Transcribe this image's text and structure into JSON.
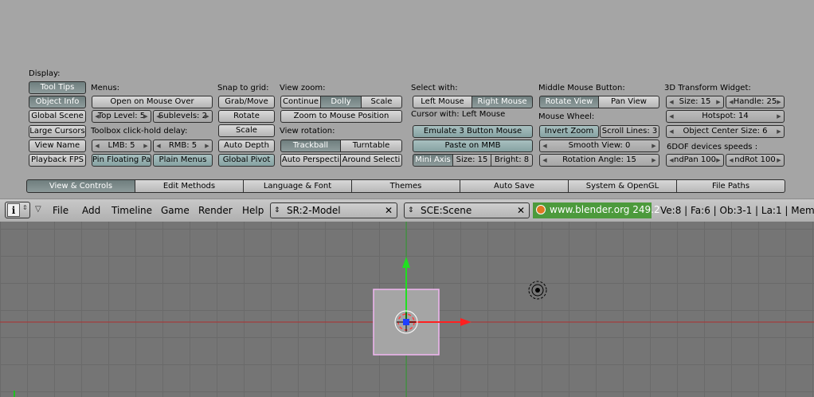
{
  "user_prefs": {
    "display": {
      "heading": "Display:",
      "buttons": [
        "Tool Tips",
        "Object Info",
        "Global Scene",
        "Large Cursors",
        "View Name",
        "Playback FPS"
      ]
    },
    "menus": {
      "heading": "Menus:",
      "open_on_mouse_over": "Open on Mouse Over",
      "top_level": "Top Level: 5",
      "sublevels": "Sublevels: 2",
      "toolbox_heading": "Toolbox click-hold delay:",
      "lmb": "LMB: 5",
      "rmb": "RMB: 5",
      "pin_floating": "Pin Floating Pa",
      "plain_menus": "Plain Menus"
    },
    "snap": {
      "heading": "Snap to grid:",
      "grab_move": "Grab/Move",
      "rotate": "Rotate",
      "scale": "Scale",
      "auto_depth": "Auto Depth",
      "global_pivot": "Global Pivot"
    },
    "view_zoom": {
      "heading": "View zoom:",
      "continue": "Continue",
      "dolly": "Dolly",
      "scale": "Scale",
      "zoom_to_mouse": "Zoom to Mouse Position",
      "rotation_heading": "View rotation:",
      "trackball": "Trackball",
      "turntable": "Turntable",
      "auto_perspective": "Auto Perspecti",
      "around_selection": "Around Selecti"
    },
    "select": {
      "heading": "Select with:",
      "left_mouse": "Left Mouse",
      "right_mouse": "Right Mouse",
      "cursor_with": "Cursor with: Left Mouse",
      "emulate_3_button": "Emulate 3 Button Mouse",
      "paste_on_mmb": "Paste on MMB",
      "mini_axis": "Mini Axis",
      "size": "Size: 15",
      "bright": "Bright: 8"
    },
    "middle_mouse": {
      "heading": "Middle Mouse Button:",
      "rotate_view": "Rotate View",
      "pan_view": "Pan View",
      "wheel_heading": "Mouse Wheel:",
      "invert_zoom": "Invert Zoom",
      "scroll_lines": "Scroll Lines: 3",
      "smooth_view": "Smooth View: 0",
      "rotation_angle": "Rotation Angle: 15"
    },
    "transform_widget": {
      "heading": "3D Transform Widget:",
      "size": "Size: 15",
      "handle": "Handle: 25",
      "hotspot": "Hotspot: 14",
      "object_center_size": "Object Center Size: 6",
      "ndof_heading": "6DOF devices speeds :",
      "ndpan": "ndPan 100",
      "ndrot": "ndRot 100"
    },
    "tabs": [
      "View & Controls",
      "Edit Methods",
      "Language & Font",
      "Themes",
      "Auto Save",
      "System & OpenGL",
      "File Paths"
    ],
    "active_tab": "View & Controls"
  },
  "header": {
    "menus": [
      "File",
      "Add",
      "Timeline",
      "Game",
      "Render",
      "Help"
    ],
    "screen": "SR:2-Model",
    "scene": "SCE:Scene",
    "website": "www.blender.org 249.2",
    "stats": "Ve:8 | Fa:6 | Ob:3-1 | La:1  | Mem"
  },
  "colors": {
    "panel_bg": "#a5a5a5",
    "active_button": "#7a8888",
    "viewport_bg": "#757575",
    "x_axis": "#e02020",
    "y_axis": "#20c020",
    "selection_outline": "#f0b0f0"
  }
}
